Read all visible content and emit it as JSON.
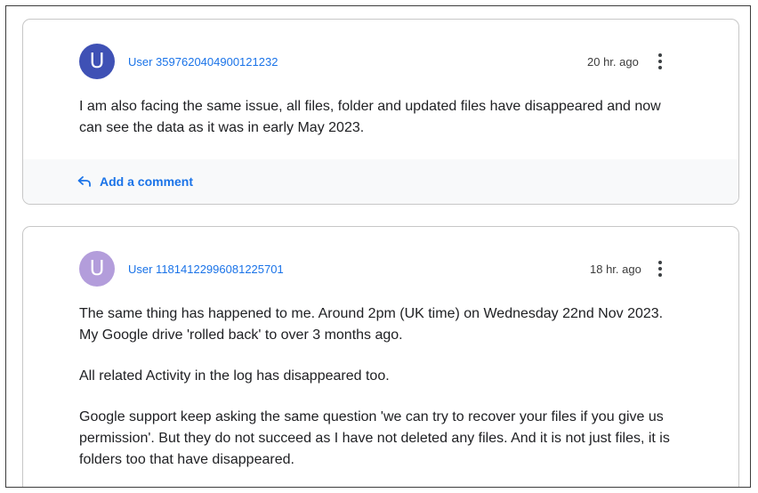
{
  "comments": [
    {
      "avatar_letter": "U",
      "avatar_color": "#3f51b5",
      "username": "User 3597620404900121232",
      "time": "20 hr. ago",
      "paragraphs": [
        "I am also facing the same issue, all files, folder and updated files have disappeared and now can see the data as it was in early May 2023."
      ],
      "add_comment_label": "Add a comment"
    },
    {
      "avatar_letter": "U",
      "avatar_color": "#b39ddb",
      "username": "User 11814122996081225701",
      "time": "18 hr. ago",
      "paragraphs": [
        "The same thing has happened to me. Around 2pm (UK time) on Wednesday 22nd Nov 2023. My Google drive 'rolled back' to over 3 months ago.",
        "All related Activity in the log has disappeared too.",
        "Google support keep asking the same question 'we can try to recover your files if you give us permission'. But they do not succeed as I have not deleted any files. And it is not just files, it is folders too that have disappeared."
      ]
    }
  ],
  "icons": {
    "more": "more-vert-icon",
    "reply": "reply-arrow-icon"
  },
  "colors": {
    "link": "#1a73e8",
    "text": "#202124",
    "footer_bg": "#f8f9fa"
  }
}
